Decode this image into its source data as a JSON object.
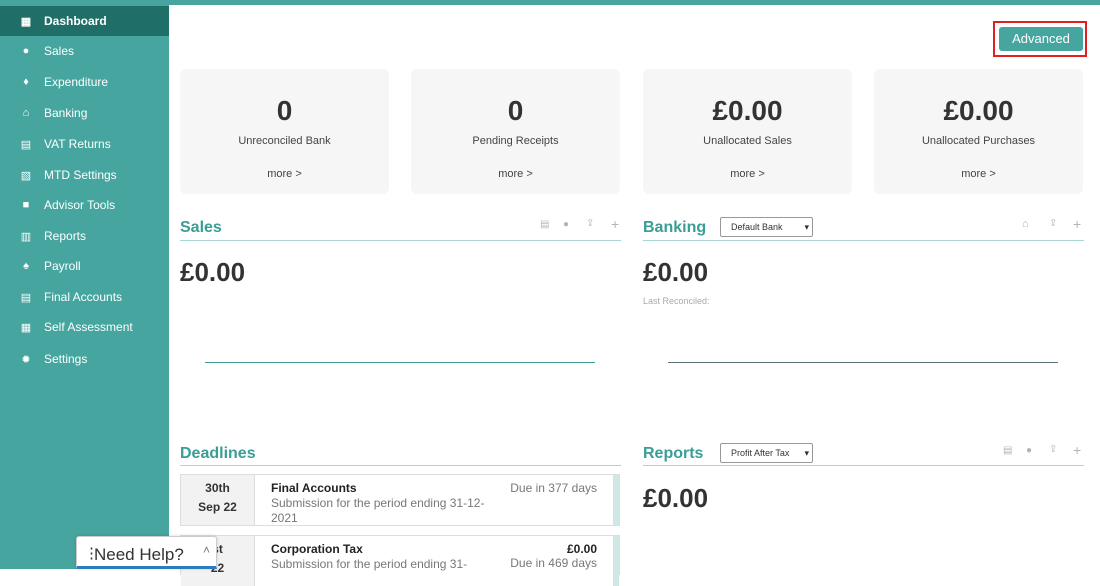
{
  "sidebar": {
    "items": [
      {
        "label": "Dashboard",
        "icon": "grid-icon",
        "glyph": "▦"
      },
      {
        "label": "Sales",
        "icon": "coin-icon",
        "glyph": "●"
      },
      {
        "label": "Expenditure",
        "icon": "money-bag-icon",
        "glyph": "♦"
      },
      {
        "label": "Banking",
        "icon": "bank-icon",
        "glyph": "⌂"
      },
      {
        "label": "VAT Returns",
        "icon": "calculator-icon",
        "glyph": "▤"
      },
      {
        "label": "MTD Settings",
        "icon": "document-icon",
        "glyph": "▧"
      },
      {
        "label": "Advisor Tools",
        "icon": "briefcase-icon",
        "glyph": "■"
      },
      {
        "label": "Reports",
        "icon": "clipboard-icon",
        "glyph": "▥"
      },
      {
        "label": "Payroll",
        "icon": "payroll-icon",
        "glyph": "♠"
      },
      {
        "label": "Final Accounts",
        "icon": "file-icon",
        "glyph": "▤"
      },
      {
        "label": "Self Assessment",
        "icon": "checklist-icon",
        "glyph": "▦"
      },
      {
        "label": "Settings",
        "icon": "gear-icon",
        "glyph": "✹"
      }
    ]
  },
  "header": {
    "advanced_label": "Advanced"
  },
  "cards": [
    {
      "value": "0",
      "label": "Unreconciled Bank",
      "more": "more >"
    },
    {
      "value": "0",
      "label": "Pending Receipts",
      "more": "more >"
    },
    {
      "value": "£0.00",
      "label": "Unallocated Sales",
      "more": "more >"
    },
    {
      "value": "£0.00",
      "label": "Unallocated Purchases",
      "more": "more >"
    }
  ],
  "sales": {
    "title": "Sales",
    "amount": "£0.00"
  },
  "banking": {
    "title": "Banking",
    "select_value": "Default Bank",
    "amount": "£0.00",
    "last_reconciled": "Last Reconciled:"
  },
  "deadlines": {
    "title": "Deadlines",
    "rows": [
      {
        "date_line1": "30th",
        "date_line2": "Sep 22",
        "title": "Final Accounts",
        "desc": "Submission for the period ending 31-12-2021",
        "due": "Due in 377 days",
        "amount": ""
      },
      {
        "date_line1": "st",
        "date_line2": "22",
        "title": "Corporation Tax",
        "desc": "Submission for the period ending 31-",
        "due": "Due in 469 days",
        "amount": "£0.00"
      }
    ]
  },
  "reports": {
    "title": "Reports",
    "select_value": "Profit After Tax",
    "amount": "£0.00"
  },
  "help": {
    "label": "Need Help?"
  },
  "colors": {
    "brand": "#46a69f",
    "active": "#1f6e68",
    "highlight": "#e02020"
  }
}
